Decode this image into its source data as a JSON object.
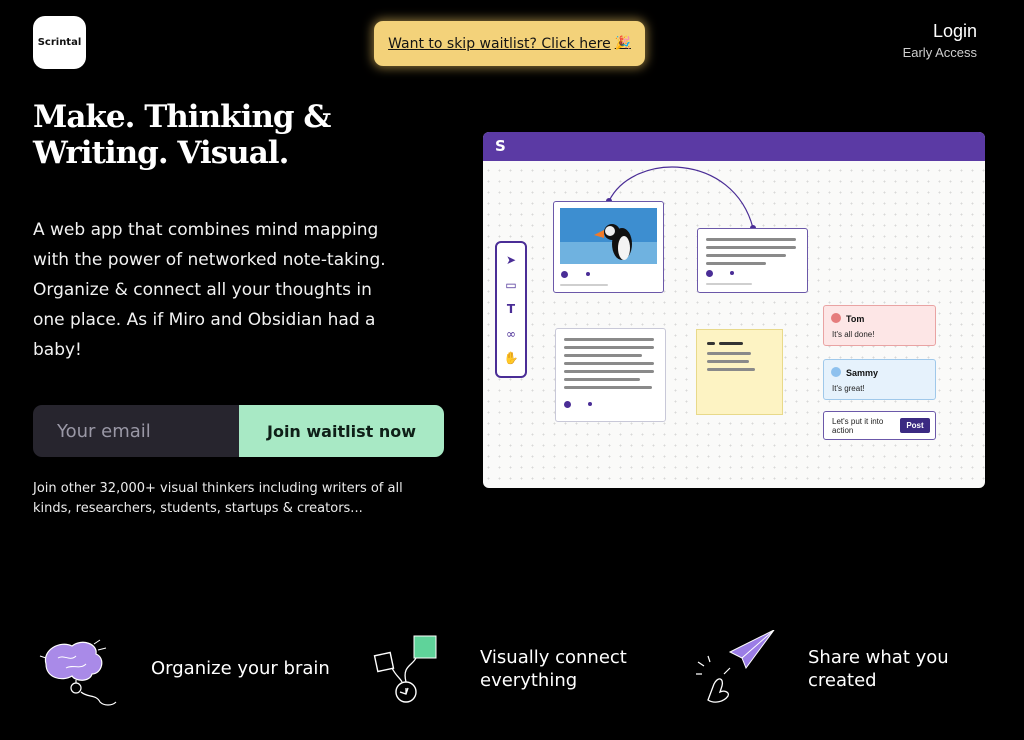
{
  "header": {
    "logo_text": "Scrintal",
    "skip_banner": "Want to skip waitlist? Click here",
    "skip_emoji": "🎉",
    "login_label": "Login",
    "early_access_label": "Early Access"
  },
  "hero": {
    "title_line1": "Make. Thinking &",
    "title_line2": "Writing. Visual.",
    "description": "A web app that combines mind mapping with the power of networked note-taking. Organize & connect all your thoughts in one place.  As if Miro and Obsidian had a baby!",
    "email_placeholder": "Your email",
    "join_button": "Join waitlist now",
    "note": "Join other 32,000+ visual thinkers including writers of all kinds, researchers, students, startups & creators..."
  },
  "app_preview": {
    "logo_letter": "S",
    "chat1": {
      "name": "Tom",
      "message": "It's all done!"
    },
    "chat2": {
      "name": "Sammy",
      "message": "It's great!"
    },
    "post_text": "Let's put it into action",
    "post_button": "Post"
  },
  "features": [
    {
      "label": "Organize your brain"
    },
    {
      "label": "Visually connect everything"
    },
    {
      "label": "Share what you created"
    }
  ],
  "colors": {
    "accent_purple": "#5b3aa4",
    "skip_yellow": "#f3d27a",
    "join_green": "#a8e9c5"
  }
}
